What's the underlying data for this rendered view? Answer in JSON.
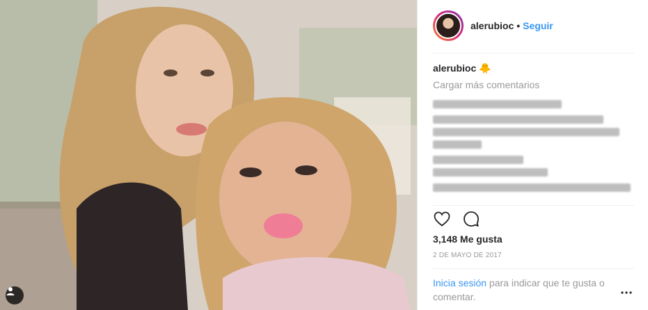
{
  "header": {
    "username": "alerubioc",
    "separator": "•",
    "follow_label": "Seguir"
  },
  "caption": {
    "username": "alerubioc",
    "emoji": "🐥"
  },
  "comments": {
    "load_more": "Cargar más comentarios"
  },
  "actions": {
    "like_icon": "heart-icon",
    "comment_icon": "comment-icon"
  },
  "likes": {
    "count_text": "3,148 Me gusta"
  },
  "date": "2 DE MAYO DE 2017",
  "login": {
    "link_text": "Inicia sesión",
    "rest_text": " para indicar que te gusta o comentar."
  },
  "colors": {
    "link_blue": "#3897f0",
    "muted": "#999999",
    "text": "#262626"
  }
}
